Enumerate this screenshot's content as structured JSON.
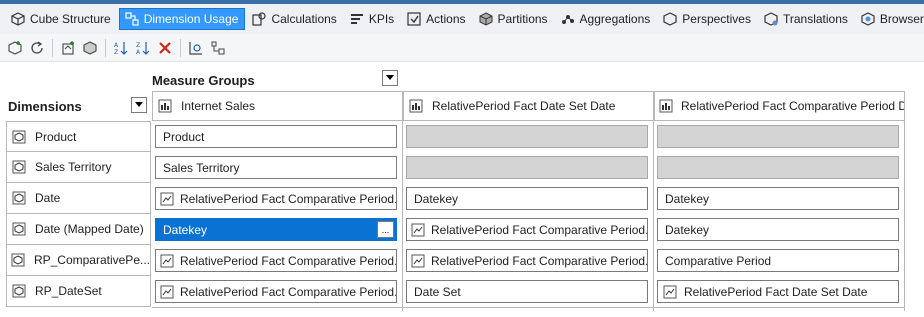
{
  "tabs": [
    {
      "label": "Cube Structure",
      "icon": "cube-structure-icon"
    },
    {
      "label": "Dimension Usage",
      "icon": "dimension-usage-icon",
      "active": true
    },
    {
      "label": "Calculations",
      "icon": "calculations-icon"
    },
    {
      "label": "KPIs",
      "icon": "kpis-icon"
    },
    {
      "label": "Actions",
      "icon": "actions-icon"
    },
    {
      "label": "Partitions",
      "icon": "partitions-icon"
    },
    {
      "label": "Aggregations",
      "icon": "aggregations-icon"
    },
    {
      "label": "Perspectives",
      "icon": "perspectives-icon"
    },
    {
      "label": "Translations",
      "icon": "translations-icon"
    },
    {
      "label": "Browser",
      "icon": "browser-icon"
    }
  ],
  "toolbar": {
    "buttons": [
      "add-cube-dimension-icon",
      "refresh-icon",
      "new-relationship-icon",
      "new-dimension-icon",
      "sort-ascending-icon",
      "sort-descending-icon",
      "delete-icon",
      "show-all-icon",
      "cube-dimension-tree-icon"
    ]
  },
  "grid": {
    "measure_groups_label": "Measure Groups",
    "dimensions_label": "Dimensions",
    "columns": [
      "Internet Sales",
      "RelativePeriod Fact Date Set Date",
      "RelativePeriod Fact Comparative Period D..."
    ],
    "rows": [
      {
        "label": "Product",
        "cells": [
          {
            "text": "Product"
          },
          {
            "empty": true
          },
          {
            "empty": true
          }
        ]
      },
      {
        "label": "Sales Territory",
        "cells": [
          {
            "text": "Sales Territory"
          },
          {
            "empty": true
          },
          {
            "empty": true
          }
        ]
      },
      {
        "label": "Date",
        "cells": [
          {
            "text": "RelativePeriod Fact Comparative Period...",
            "icon": true
          },
          {
            "text": "Datekey"
          },
          {
            "text": "Datekey"
          }
        ]
      },
      {
        "label": "Date (Mapped Date)",
        "cells": [
          {
            "text": "Datekey",
            "selected": true
          },
          {
            "text": "RelativePeriod Fact Comparative Period...",
            "icon": true
          },
          {
            "text": "Datekey"
          }
        ]
      },
      {
        "label": "RP_ComparativePe...",
        "cells": [
          {
            "text": "RelativePeriod Fact Comparative Period...",
            "icon": true
          },
          {
            "text": "RelativePeriod Fact Comparative Period...",
            "icon": true
          },
          {
            "text": "Comparative Period"
          }
        ]
      },
      {
        "label": "RP_DateSet",
        "cells": [
          {
            "text": "RelativePeriod Fact Comparative Period...",
            "icon": true
          },
          {
            "text": "Date Set"
          },
          {
            "text": "RelativePeriod Fact Date Set Date",
            "icon": true
          }
        ]
      }
    ],
    "ellipsis_label": "...",
    "colors": {
      "selected": "#0a72d2",
      "empty": "#d4d4d4",
      "active_tab": "#3399ff"
    }
  }
}
